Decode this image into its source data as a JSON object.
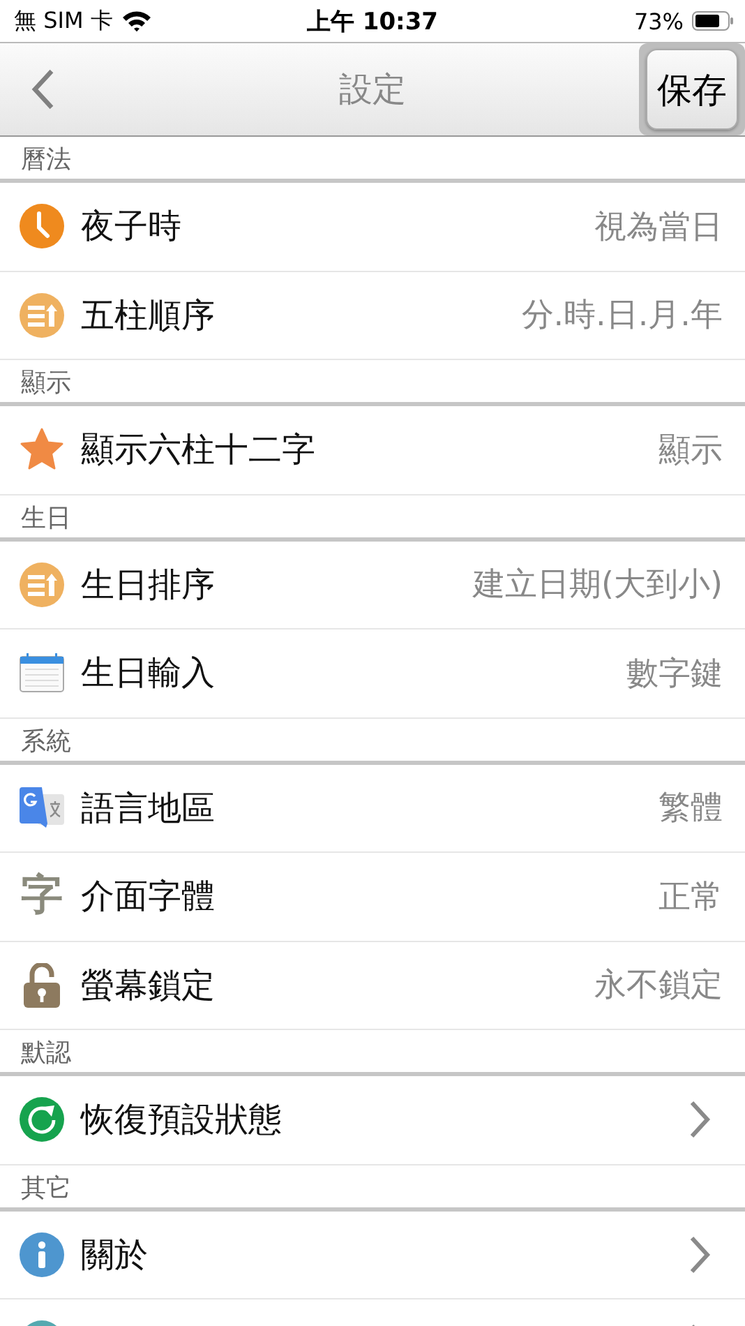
{
  "status_bar": {
    "carrier": "無 SIM 卡",
    "time": "上午 10:37",
    "battery": "73%"
  },
  "nav": {
    "title": "設定",
    "save": "保存"
  },
  "sections": [
    {
      "title": "曆法",
      "items": [
        {
          "kind": "clock",
          "label": "夜子時",
          "value": "視為當日",
          "chevron": false
        },
        {
          "kind": "list",
          "label": "五柱順序",
          "value": "分.時.日.月.年",
          "chevron": false
        }
      ]
    },
    {
      "title": "顯示",
      "items": [
        {
          "kind": "star",
          "label": "顯示六柱十二字",
          "value": "顯示",
          "chevron": false
        }
      ]
    },
    {
      "title": "生日",
      "items": [
        {
          "kind": "list",
          "label": "生日排序",
          "value": "建立日期(大到小)",
          "chevron": false
        },
        {
          "kind": "calendar",
          "label": "生日輸入",
          "value": "數字鍵",
          "chevron": false
        }
      ]
    },
    {
      "title": "系統",
      "items": [
        {
          "kind": "translate",
          "label": "語言地區",
          "value": "繁體",
          "chevron": false
        },
        {
          "kind": "glyph",
          "glyph": "字",
          "label": "介面字體",
          "value": "正常",
          "chevron": false
        },
        {
          "kind": "lock",
          "label": "螢幕鎖定",
          "value": "永不鎖定",
          "chevron": false
        }
      ]
    },
    {
      "title": "默認",
      "items": [
        {
          "kind": "refresh",
          "label": "恢復預設狀態",
          "chevron": true
        }
      ]
    },
    {
      "title": "其它",
      "items": [
        {
          "kind": "info",
          "label": "關於",
          "chevron": true
        },
        {
          "kind": "dot",
          "chevron": true
        }
      ]
    }
  ]
}
